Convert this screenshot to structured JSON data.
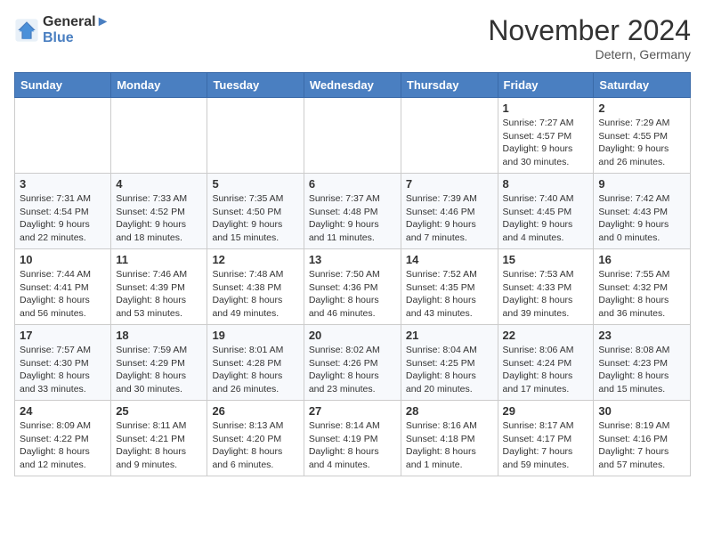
{
  "header": {
    "logo_line1": "General",
    "logo_line2": "Blue",
    "month_title": "November 2024",
    "location": "Detern, Germany"
  },
  "weekdays": [
    "Sunday",
    "Monday",
    "Tuesday",
    "Wednesday",
    "Thursday",
    "Friday",
    "Saturday"
  ],
  "weeks": [
    [
      {
        "day": "",
        "info": ""
      },
      {
        "day": "",
        "info": ""
      },
      {
        "day": "",
        "info": ""
      },
      {
        "day": "",
        "info": ""
      },
      {
        "day": "",
        "info": ""
      },
      {
        "day": "1",
        "info": "Sunrise: 7:27 AM\nSunset: 4:57 PM\nDaylight: 9 hours and 30 minutes."
      },
      {
        "day": "2",
        "info": "Sunrise: 7:29 AM\nSunset: 4:55 PM\nDaylight: 9 hours and 26 minutes."
      }
    ],
    [
      {
        "day": "3",
        "info": "Sunrise: 7:31 AM\nSunset: 4:54 PM\nDaylight: 9 hours and 22 minutes."
      },
      {
        "day": "4",
        "info": "Sunrise: 7:33 AM\nSunset: 4:52 PM\nDaylight: 9 hours and 18 minutes."
      },
      {
        "day": "5",
        "info": "Sunrise: 7:35 AM\nSunset: 4:50 PM\nDaylight: 9 hours and 15 minutes."
      },
      {
        "day": "6",
        "info": "Sunrise: 7:37 AM\nSunset: 4:48 PM\nDaylight: 9 hours and 11 minutes."
      },
      {
        "day": "7",
        "info": "Sunrise: 7:39 AM\nSunset: 4:46 PM\nDaylight: 9 hours and 7 minutes."
      },
      {
        "day": "8",
        "info": "Sunrise: 7:40 AM\nSunset: 4:45 PM\nDaylight: 9 hours and 4 minutes."
      },
      {
        "day": "9",
        "info": "Sunrise: 7:42 AM\nSunset: 4:43 PM\nDaylight: 9 hours and 0 minutes."
      }
    ],
    [
      {
        "day": "10",
        "info": "Sunrise: 7:44 AM\nSunset: 4:41 PM\nDaylight: 8 hours and 56 minutes."
      },
      {
        "day": "11",
        "info": "Sunrise: 7:46 AM\nSunset: 4:39 PM\nDaylight: 8 hours and 53 minutes."
      },
      {
        "day": "12",
        "info": "Sunrise: 7:48 AM\nSunset: 4:38 PM\nDaylight: 8 hours and 49 minutes."
      },
      {
        "day": "13",
        "info": "Sunrise: 7:50 AM\nSunset: 4:36 PM\nDaylight: 8 hours and 46 minutes."
      },
      {
        "day": "14",
        "info": "Sunrise: 7:52 AM\nSunset: 4:35 PM\nDaylight: 8 hours and 43 minutes."
      },
      {
        "day": "15",
        "info": "Sunrise: 7:53 AM\nSunset: 4:33 PM\nDaylight: 8 hours and 39 minutes."
      },
      {
        "day": "16",
        "info": "Sunrise: 7:55 AM\nSunset: 4:32 PM\nDaylight: 8 hours and 36 minutes."
      }
    ],
    [
      {
        "day": "17",
        "info": "Sunrise: 7:57 AM\nSunset: 4:30 PM\nDaylight: 8 hours and 33 minutes."
      },
      {
        "day": "18",
        "info": "Sunrise: 7:59 AM\nSunset: 4:29 PM\nDaylight: 8 hours and 30 minutes."
      },
      {
        "day": "19",
        "info": "Sunrise: 8:01 AM\nSunset: 4:28 PM\nDaylight: 8 hours and 26 minutes."
      },
      {
        "day": "20",
        "info": "Sunrise: 8:02 AM\nSunset: 4:26 PM\nDaylight: 8 hours and 23 minutes."
      },
      {
        "day": "21",
        "info": "Sunrise: 8:04 AM\nSunset: 4:25 PM\nDaylight: 8 hours and 20 minutes."
      },
      {
        "day": "22",
        "info": "Sunrise: 8:06 AM\nSunset: 4:24 PM\nDaylight: 8 hours and 17 minutes."
      },
      {
        "day": "23",
        "info": "Sunrise: 8:08 AM\nSunset: 4:23 PM\nDaylight: 8 hours and 15 minutes."
      }
    ],
    [
      {
        "day": "24",
        "info": "Sunrise: 8:09 AM\nSunset: 4:22 PM\nDaylight: 8 hours and 12 minutes."
      },
      {
        "day": "25",
        "info": "Sunrise: 8:11 AM\nSunset: 4:21 PM\nDaylight: 8 hours and 9 minutes."
      },
      {
        "day": "26",
        "info": "Sunrise: 8:13 AM\nSunset: 4:20 PM\nDaylight: 8 hours and 6 minutes."
      },
      {
        "day": "27",
        "info": "Sunrise: 8:14 AM\nSunset: 4:19 PM\nDaylight: 8 hours and 4 minutes."
      },
      {
        "day": "28",
        "info": "Sunrise: 8:16 AM\nSunset: 4:18 PM\nDaylight: 8 hours and 1 minute."
      },
      {
        "day": "29",
        "info": "Sunrise: 8:17 AM\nSunset: 4:17 PM\nDaylight: 7 hours and 59 minutes."
      },
      {
        "day": "30",
        "info": "Sunrise: 8:19 AM\nSunset: 4:16 PM\nDaylight: 7 hours and 57 minutes."
      }
    ]
  ]
}
